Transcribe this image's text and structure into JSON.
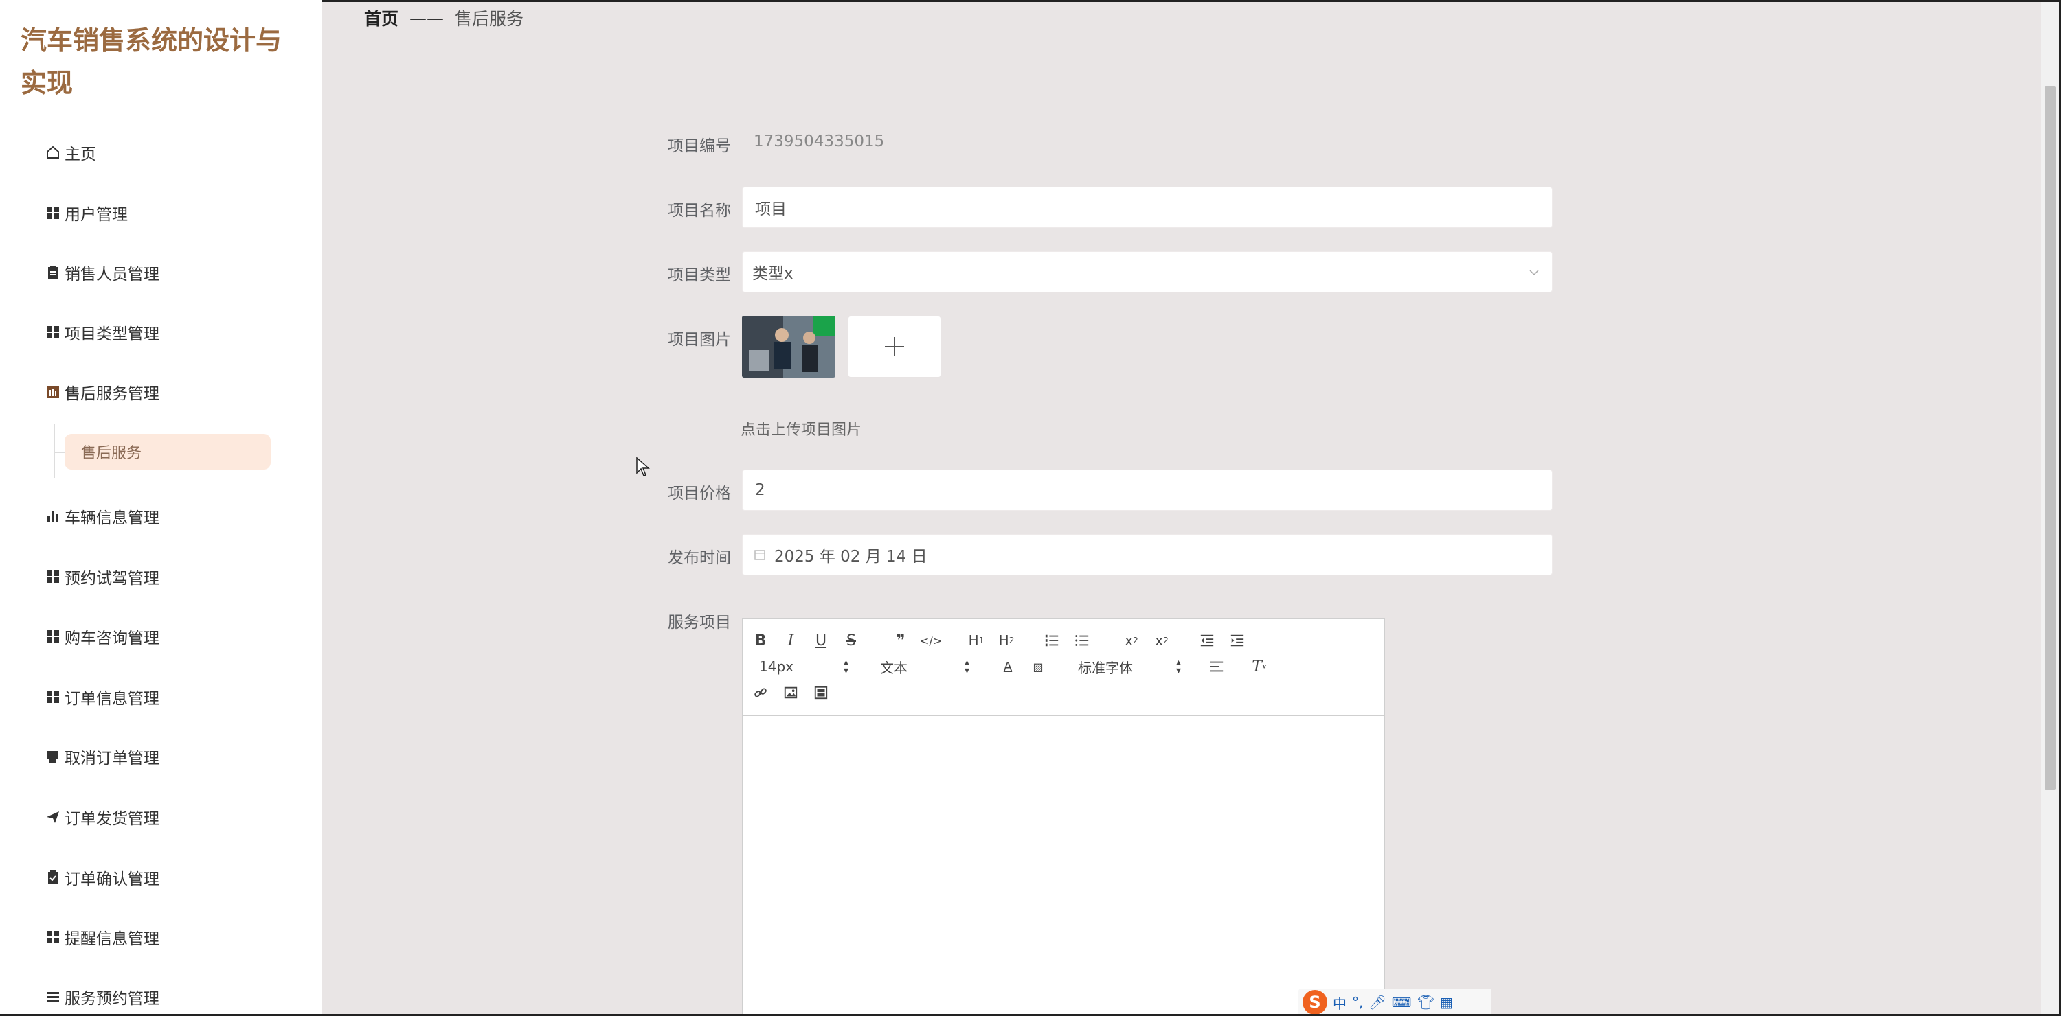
{
  "app": {
    "title": "汽车销售系统的设计与实现"
  },
  "breadcrumb": {
    "home": "首页",
    "separator": "——",
    "current": "售后服务"
  },
  "sidebar": {
    "items": [
      {
        "label": "主页",
        "icon": "home-icon"
      },
      {
        "label": "用户管理",
        "icon": "grid-icon"
      },
      {
        "label": "销售人员管理",
        "icon": "clipboard-icon"
      },
      {
        "label": "项目类型管理",
        "icon": "grid-icon"
      },
      {
        "label": "售后服务管理",
        "icon": "chart-bars-icon"
      },
      {
        "label": "车辆信息管理",
        "icon": "bar-chart-icon"
      },
      {
        "label": "预约试驾管理",
        "icon": "grid-icon"
      },
      {
        "label": "购车咨询管理",
        "icon": "grid-icon"
      },
      {
        "label": "订单信息管理",
        "icon": "grid-icon"
      },
      {
        "label": "取消订单管理",
        "icon": "printer-icon"
      },
      {
        "label": "订单发货管理",
        "icon": "send-icon"
      },
      {
        "label": "订单确认管理",
        "icon": "clipboard-check-icon"
      },
      {
        "label": "提醒信息管理",
        "icon": "grid-icon"
      },
      {
        "label": "服务预约管理",
        "icon": "list-icon"
      }
    ],
    "sub_item": "售后服务"
  },
  "form": {
    "id_label": "项目编号",
    "id_value": "1739504335015",
    "name_label": "项目名称",
    "name_value": "项目",
    "type_label": "项目类型",
    "type_value": "类型x",
    "image_label": "项目图片",
    "upload_hint": "点击上传项目图片",
    "price_label": "项目价格",
    "price_value": "2",
    "date_label": "发布时间",
    "date_value": "2025 年 02 月 14 日",
    "service_label": "服务项目"
  },
  "editor": {
    "font_size": "14px",
    "text_style": "文本",
    "font_family": "标准字体"
  },
  "ime": {
    "logo": "S",
    "mode": "中",
    "punct": "°,"
  },
  "colors": {
    "accent_title": "#9b6a40",
    "sub_active_bg": "#fde9dd",
    "page_bg": "#e9e5e5"
  }
}
